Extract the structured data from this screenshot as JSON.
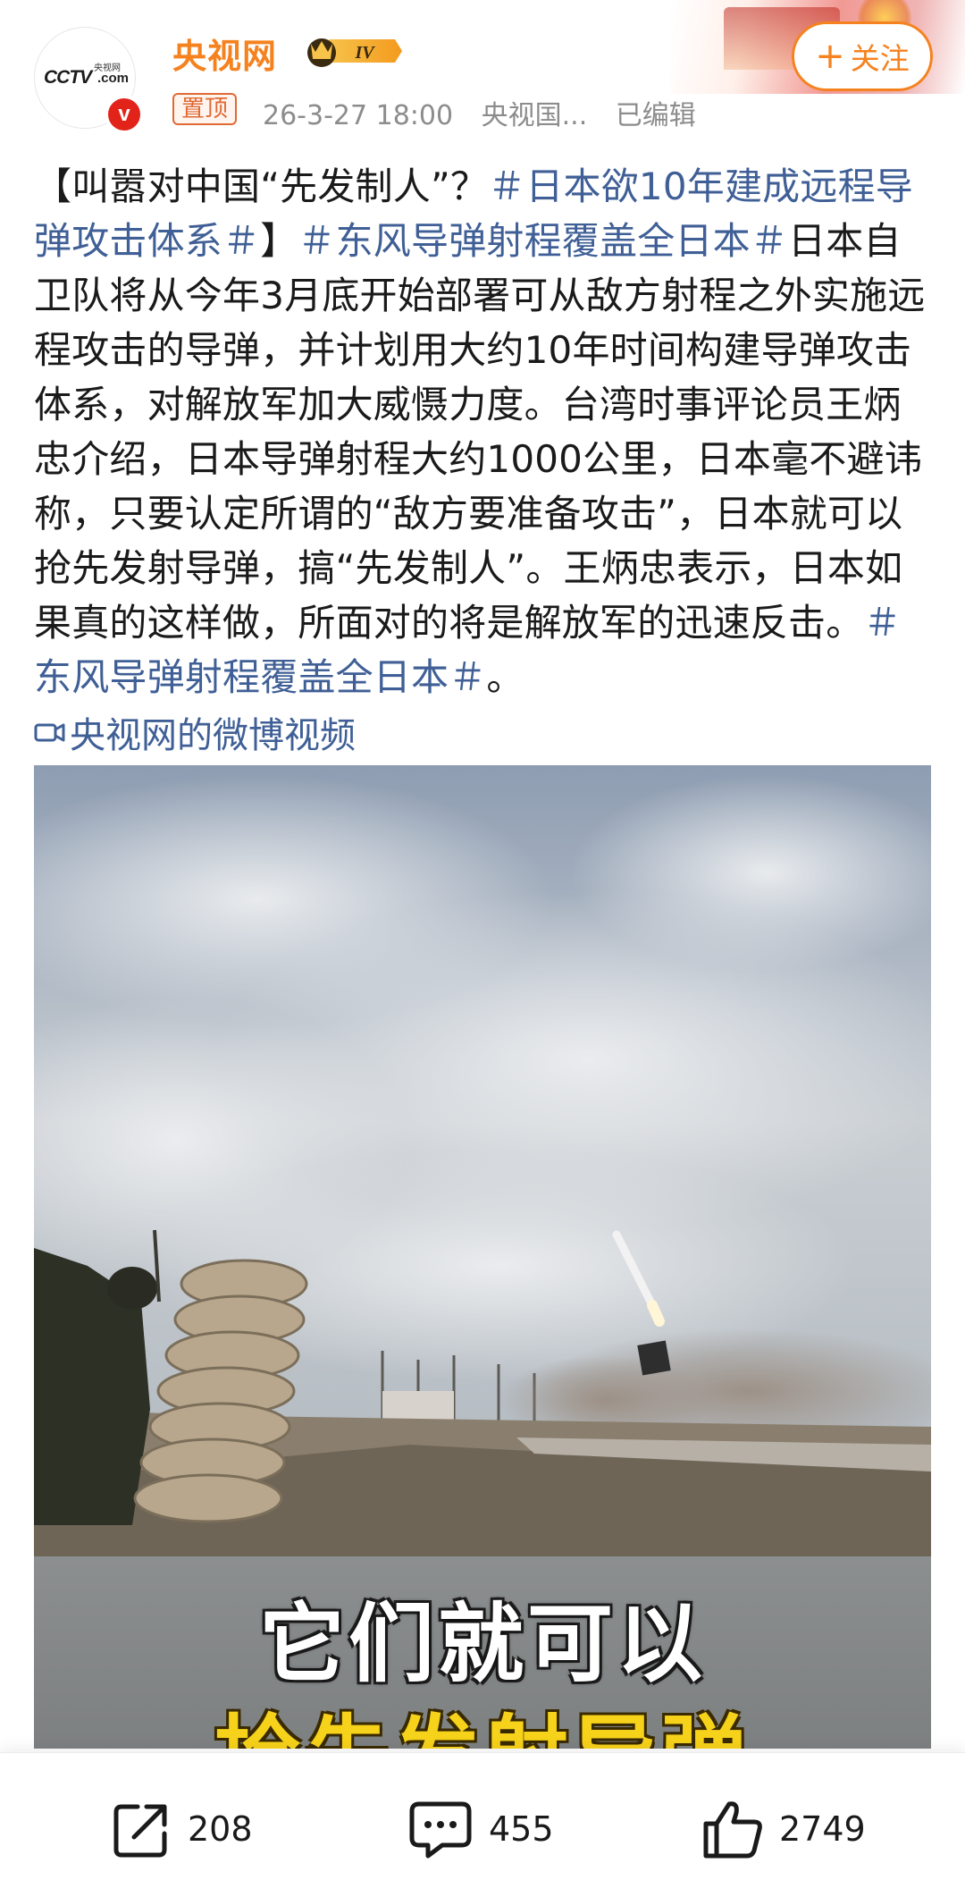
{
  "account": {
    "name": "央视网",
    "avatar_text": "CCTV",
    "avatar_subtext": "央视网",
    "avatar_domain": ".com",
    "verified_icon": "v",
    "level_label": "IV",
    "follow_label": "关注",
    "follow_icon": "+"
  },
  "post_meta": {
    "pin_label": "置顶",
    "time": "26-3-27 18:00",
    "source": "央视国...",
    "edited": "已编辑"
  },
  "post": {
    "segments": [
      {
        "text": "【叫嚣对中国“先发制人”？",
        "topic": false
      },
      {
        "text": "＃日本欲10年建成远程导弹攻击体系＃",
        "topic": true
      },
      {
        "text": "】",
        "topic": false
      },
      {
        "text": "＃东风导弹射程覆盖全日本＃",
        "topic": true
      },
      {
        "text": "日本自卫队将从今年3月底开始部署可从敌方射程之外实施远程攻击的导弹，并计划用大约10年时间构建导弹攻击体系，对解放军加大威慑力度。台湾时事评论员王炳忠介绍，日本导弹射程大约1000公里，日本毫不避讳称，只要认定所谓的“敌方要准备攻击”，日本就可以抢先发射导弹，搞“先发制人”。王炳忠表示，日本如果真的这样做，所面对的将是解放军的迅速反击。",
        "topic": false
      },
      {
        "text": "＃东风导弹射程覆盖全日本＃",
        "topic": true
      },
      {
        "text": "。",
        "topic": false
      }
    ],
    "video_link_label": "央视网的微博视频"
  },
  "video": {
    "caption_line1": "它们就可以",
    "caption_line2": "抢先发射导弹",
    "caption_line1_color": "#ffffff",
    "caption_line2_color": "#f6d21a"
  },
  "actions": {
    "repost_count": "208",
    "comment_count": "455",
    "like_count": "2749",
    "repost_icon": "share-icon",
    "comment_icon": "comment-icon",
    "like_icon": "thumbs-up-icon"
  },
  "colors": {
    "brand_orange": "#f5821f",
    "topic_blue": "#3f5f96",
    "verified_red": "#e2231a"
  }
}
